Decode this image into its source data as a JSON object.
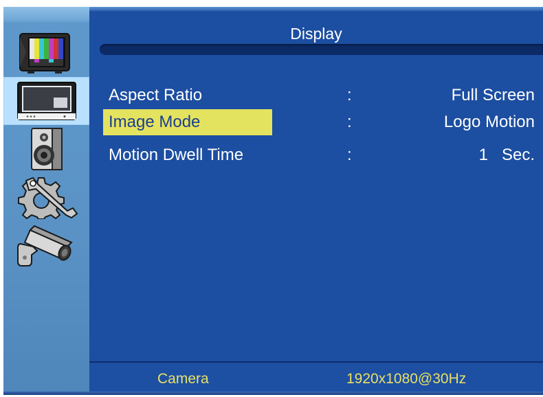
{
  "menu": {
    "title": "Display",
    "rows": [
      {
        "label": "Aspect Ratio",
        "sep": ":",
        "value": "Full Screen"
      },
      {
        "label": "Image Mode",
        "sep": ":",
        "value": "Logo Motion"
      },
      {
        "label": "Motion Dwell Time",
        "sep": ":",
        "value_number": "1",
        "value_unit": "Sec."
      }
    ]
  },
  "sidebar": {
    "items": [
      {
        "icon": "color-bars-tv-icon"
      },
      {
        "icon": "monitor-icon",
        "selected": true
      },
      {
        "icon": "speaker-icon"
      },
      {
        "icon": "tools-gear-icon"
      },
      {
        "icon": "security-camera-icon"
      }
    ]
  },
  "footer": {
    "source": "Camera",
    "resolution": "1920x1080@30Hz"
  },
  "colors": {
    "background": "#1c4ea1",
    "sidebar": "#5a92c5",
    "highlight": "#e4e35f",
    "footer_text": "#e8e164"
  }
}
